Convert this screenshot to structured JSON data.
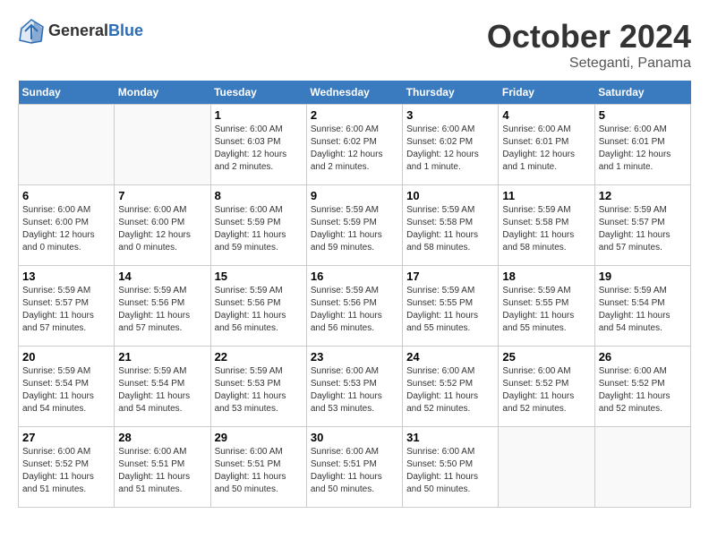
{
  "header": {
    "logo_line1": "General",
    "logo_line2": "Blue",
    "month": "October 2024",
    "location": "Seteganti, Panama"
  },
  "days_of_week": [
    "Sunday",
    "Monday",
    "Tuesday",
    "Wednesday",
    "Thursday",
    "Friday",
    "Saturday"
  ],
  "weeks": [
    [
      {
        "day": "",
        "info": ""
      },
      {
        "day": "",
        "info": ""
      },
      {
        "day": "1",
        "info": "Sunrise: 6:00 AM\nSunset: 6:03 PM\nDaylight: 12 hours\nand 2 minutes."
      },
      {
        "day": "2",
        "info": "Sunrise: 6:00 AM\nSunset: 6:02 PM\nDaylight: 12 hours\nand 2 minutes."
      },
      {
        "day": "3",
        "info": "Sunrise: 6:00 AM\nSunset: 6:02 PM\nDaylight: 12 hours\nand 1 minute."
      },
      {
        "day": "4",
        "info": "Sunrise: 6:00 AM\nSunset: 6:01 PM\nDaylight: 12 hours\nand 1 minute."
      },
      {
        "day": "5",
        "info": "Sunrise: 6:00 AM\nSunset: 6:01 PM\nDaylight: 12 hours\nand 1 minute."
      }
    ],
    [
      {
        "day": "6",
        "info": "Sunrise: 6:00 AM\nSunset: 6:00 PM\nDaylight: 12 hours\nand 0 minutes."
      },
      {
        "day": "7",
        "info": "Sunrise: 6:00 AM\nSunset: 6:00 PM\nDaylight: 12 hours\nand 0 minutes."
      },
      {
        "day": "8",
        "info": "Sunrise: 6:00 AM\nSunset: 5:59 PM\nDaylight: 11 hours\nand 59 minutes."
      },
      {
        "day": "9",
        "info": "Sunrise: 5:59 AM\nSunset: 5:59 PM\nDaylight: 11 hours\nand 59 minutes."
      },
      {
        "day": "10",
        "info": "Sunrise: 5:59 AM\nSunset: 5:58 PM\nDaylight: 11 hours\nand 58 minutes."
      },
      {
        "day": "11",
        "info": "Sunrise: 5:59 AM\nSunset: 5:58 PM\nDaylight: 11 hours\nand 58 minutes."
      },
      {
        "day": "12",
        "info": "Sunrise: 5:59 AM\nSunset: 5:57 PM\nDaylight: 11 hours\nand 57 minutes."
      }
    ],
    [
      {
        "day": "13",
        "info": "Sunrise: 5:59 AM\nSunset: 5:57 PM\nDaylight: 11 hours\nand 57 minutes."
      },
      {
        "day": "14",
        "info": "Sunrise: 5:59 AM\nSunset: 5:56 PM\nDaylight: 11 hours\nand 57 minutes."
      },
      {
        "day": "15",
        "info": "Sunrise: 5:59 AM\nSunset: 5:56 PM\nDaylight: 11 hours\nand 56 minutes."
      },
      {
        "day": "16",
        "info": "Sunrise: 5:59 AM\nSunset: 5:56 PM\nDaylight: 11 hours\nand 56 minutes."
      },
      {
        "day": "17",
        "info": "Sunrise: 5:59 AM\nSunset: 5:55 PM\nDaylight: 11 hours\nand 55 minutes."
      },
      {
        "day": "18",
        "info": "Sunrise: 5:59 AM\nSunset: 5:55 PM\nDaylight: 11 hours\nand 55 minutes."
      },
      {
        "day": "19",
        "info": "Sunrise: 5:59 AM\nSunset: 5:54 PM\nDaylight: 11 hours\nand 54 minutes."
      }
    ],
    [
      {
        "day": "20",
        "info": "Sunrise: 5:59 AM\nSunset: 5:54 PM\nDaylight: 11 hours\nand 54 minutes."
      },
      {
        "day": "21",
        "info": "Sunrise: 5:59 AM\nSunset: 5:54 PM\nDaylight: 11 hours\nand 54 minutes."
      },
      {
        "day": "22",
        "info": "Sunrise: 5:59 AM\nSunset: 5:53 PM\nDaylight: 11 hours\nand 53 minutes."
      },
      {
        "day": "23",
        "info": "Sunrise: 6:00 AM\nSunset: 5:53 PM\nDaylight: 11 hours\nand 53 minutes."
      },
      {
        "day": "24",
        "info": "Sunrise: 6:00 AM\nSunset: 5:52 PM\nDaylight: 11 hours\nand 52 minutes."
      },
      {
        "day": "25",
        "info": "Sunrise: 6:00 AM\nSunset: 5:52 PM\nDaylight: 11 hours\nand 52 minutes."
      },
      {
        "day": "26",
        "info": "Sunrise: 6:00 AM\nSunset: 5:52 PM\nDaylight: 11 hours\nand 52 minutes."
      }
    ],
    [
      {
        "day": "27",
        "info": "Sunrise: 6:00 AM\nSunset: 5:52 PM\nDaylight: 11 hours\nand 51 minutes."
      },
      {
        "day": "28",
        "info": "Sunrise: 6:00 AM\nSunset: 5:51 PM\nDaylight: 11 hours\nand 51 minutes."
      },
      {
        "day": "29",
        "info": "Sunrise: 6:00 AM\nSunset: 5:51 PM\nDaylight: 11 hours\nand 50 minutes."
      },
      {
        "day": "30",
        "info": "Sunrise: 6:00 AM\nSunset: 5:51 PM\nDaylight: 11 hours\nand 50 minutes."
      },
      {
        "day": "31",
        "info": "Sunrise: 6:00 AM\nSunset: 5:50 PM\nDaylight: 11 hours\nand 50 minutes."
      },
      {
        "day": "",
        "info": ""
      },
      {
        "day": "",
        "info": ""
      }
    ]
  ]
}
